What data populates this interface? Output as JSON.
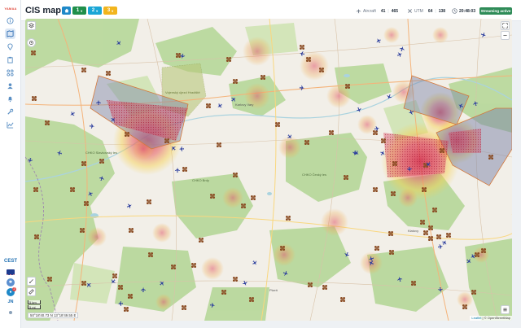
{
  "app": {
    "logo_text": "YAMAA",
    "title": "CIS map"
  },
  "header": {
    "chips": [
      {
        "label": "",
        "icon": "home-icon",
        "color": "#1e88c8"
      },
      {
        "label": "1",
        "color": "#1f8f4a"
      },
      {
        "label": "2",
        "color": "#1aa6d6"
      },
      {
        "label": "3",
        "color": "#f2b51d"
      }
    ],
    "stats": [
      {
        "label": "Aircraft",
        "icon": "plane-icon",
        "value_a": "41",
        "value_b": "465"
      },
      {
        "label": "UTM",
        "icon": "utm-icon",
        "value_a": "64",
        "value_b": "138"
      },
      {
        "label": "",
        "icon": "clock-icon",
        "value_a": "20:48:03",
        "value_b": ""
      }
    ],
    "streaming_label": "Streaming active",
    "streaming_color": "#2e8b57"
  },
  "sidebar": {
    "items": [
      {
        "icon": "info-icon"
      },
      {
        "icon": "map-icon",
        "active": true
      },
      {
        "icon": "pin-icon"
      },
      {
        "icon": "clipboard-icon"
      },
      {
        "icon": "drone-icon"
      },
      {
        "icon": "users-icon"
      },
      {
        "icon": "bell-icon"
      },
      {
        "icon": "wrench-icon"
      },
      {
        "icon": "chart-icon"
      }
    ],
    "country_code": "CEST",
    "user_initials": "JN",
    "notification_count": "2"
  },
  "map": {
    "place_labels": [
      "CHKO Slavkovský les",
      "CHKO Český les",
      "CHKO Brdy",
      "Vojenský újezd Hradiště",
      "Karlovy Vary",
      "Plzeň",
      "Klatovy"
    ],
    "scale_km": "5 km",
    "scale_mi": "5 mi",
    "coords_readout": "50°18'40.73 N 13°18'49.55 E",
    "attribution_leaflet": "Leaflet",
    "attribution_osm": "© OpenStreetMap",
    "colors": {
      "heat_core": "#d6334f",
      "heat_outer": "#f7d04a",
      "zone": "#7b83a8",
      "drone": "#8a4b22",
      "aircraft": "#2d3f9e",
      "forest": "#b5d69a",
      "water": "#aad3df"
    }
  }
}
